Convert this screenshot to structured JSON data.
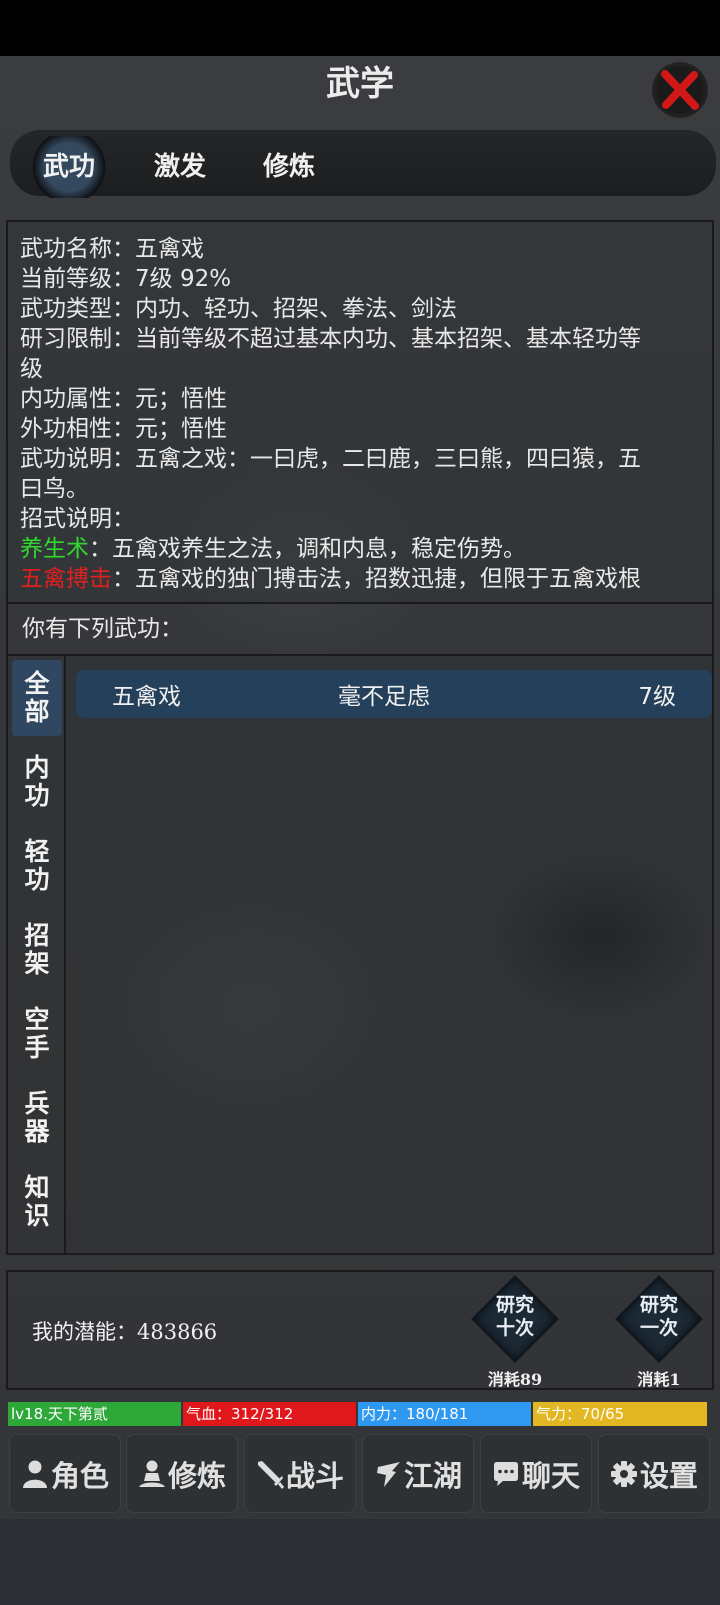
{
  "header": {
    "title": "武学"
  },
  "tabs": [
    {
      "label": "武功",
      "active": true
    },
    {
      "label": "激发",
      "active": false
    },
    {
      "label": "修炼",
      "active": false
    }
  ],
  "info": {
    "name_label": "武功名称：",
    "name": "五禽戏",
    "level_label": "当前等级：",
    "level": "7级  92%",
    "type_label": "武功类型：",
    "type": "内功、轻功、招架、拳法、剑法",
    "limit_label": "研习限制：",
    "limit_1": "当前等级不超过基本内功、基本招架、基本轻功等",
    "limit_2": "级",
    "inner_label": "内功属性：",
    "inner": "元；悟性",
    "outer_label": "外功相性：",
    "outer": "元；悟性",
    "desc_label": "武功说明：",
    "desc_1": "五禽之戏：一曰虎，二曰鹿，三曰熊，四曰猿，五",
    "desc_2": "曰鸟。",
    "moves_label": "招式说明：",
    "move1_name": "养生术",
    "move1_desc": "：五禽戏养生之法，调和内息，稳定伤势。",
    "move2_name": "五禽搏击",
    "move2_desc": "：五禽戏的独门搏击法，招数迅捷，但限于五禽戏根"
  },
  "owned_label": "你有下列武功：",
  "categories": [
    {
      "l1": "全",
      "l2": "部",
      "active": true
    },
    {
      "l1": "内",
      "l2": "功",
      "active": false
    },
    {
      "l1": "轻",
      "l2": "功",
      "active": false
    },
    {
      "l1": "招",
      "l2": "架",
      "active": false
    },
    {
      "l1": "空",
      "l2": "手",
      "active": false
    },
    {
      "l1": "兵",
      "l2": "器",
      "active": false
    },
    {
      "l1": "知",
      "l2": "识",
      "active": false
    }
  ],
  "skills": [
    {
      "name": "五禽戏",
      "rating": "毫不足虑",
      "level": "7级"
    }
  ],
  "potential": {
    "label": "我的潜能：",
    "value": "483866"
  },
  "research": [
    {
      "line1": "研究",
      "line2": "十次",
      "cost": "消耗89"
    },
    {
      "line1": "研究",
      "line2": "一次",
      "cost": "消耗1"
    }
  ],
  "stats": {
    "level": "lv18.天下第贰",
    "hp": "气血：312/312",
    "mp": "内力：180/181",
    "qi": "气力：70/65"
  },
  "nav": [
    {
      "label": "角色",
      "icon": "person-icon"
    },
    {
      "label": "修炼",
      "icon": "meditate-icon"
    },
    {
      "label": "战斗",
      "icon": "sword-icon"
    },
    {
      "label": "江湖",
      "icon": "wuxia-icon"
    },
    {
      "label": "聊天",
      "icon": "chat-icon"
    },
    {
      "label": "设置",
      "icon": "gear-icon"
    }
  ],
  "colors": {
    "accent": "#2f4760",
    "green": "#2fd82f",
    "red": "#e02020"
  }
}
